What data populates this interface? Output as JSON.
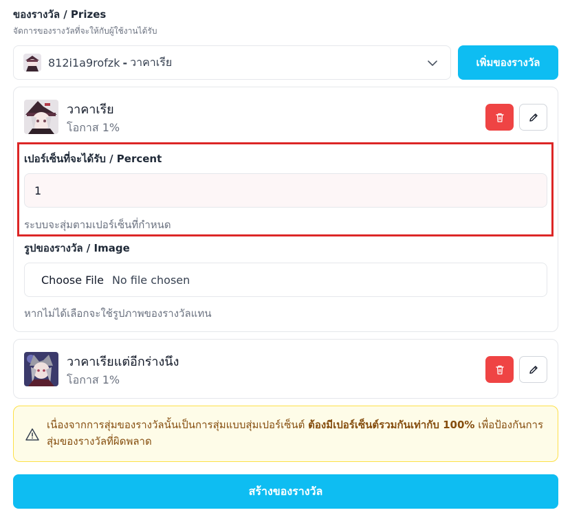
{
  "header": {
    "title": "ของรางวัล / Prizes",
    "subtitle": "จัดการของรางวัลที่จะให้กับผู้ใช้งานได้รับ"
  },
  "selector": {
    "selected_id": "812i1a9rofzk",
    "separator": "-",
    "selected_name": "วาคาเรีย"
  },
  "add_button_label": "เพิ่มของรางวัล",
  "prizes": [
    {
      "name": "วาคาเรีย",
      "chance": "โอกาส 1%"
    },
    {
      "name": "วาคาเรียแต่อีกร่างนึง",
      "chance": "โอกาส 1%"
    }
  ],
  "edit_form": {
    "percent_label": "เปอร์เซ็นที่จะได้รับ / Percent",
    "percent_value": "1",
    "percent_help": "ระบบจะสุ่มตามเปอร์เซ็นที่กำหนด",
    "image_label": "รูปของรางวัล / Image",
    "file_button": "Choose File",
    "file_status": "No file chosen",
    "image_help": "หากไม่ได้เลือกจะใช้รูปภาพของรางวัลแทน"
  },
  "alert": {
    "text_before": "เนื่องจากการสุ่มของรางวัลนั้นเป็นการสุ่มแบบสุ่มเปอร์เซ็นต์ ",
    "text_bold": "ต้องมีเปอร์เซ็นต์รวมกันเท่ากับ 100%",
    "text_after": " เพื่อป้องกันการสุ่มของรางวัลที่ผิดพลาด"
  },
  "create_button_label": "สร้างของรางวัล",
  "colors": {
    "accent": "#0ebdf2",
    "danger": "#ef4444",
    "highlight_border": "#dc2626",
    "alert_bg": "#fefce8",
    "alert_text": "#854d0e"
  },
  "icons": {
    "delete": "trash-icon",
    "edit": "pencil-icon",
    "dropdown": "chevron-down-icon",
    "alert": "warning-triangle-icon"
  }
}
